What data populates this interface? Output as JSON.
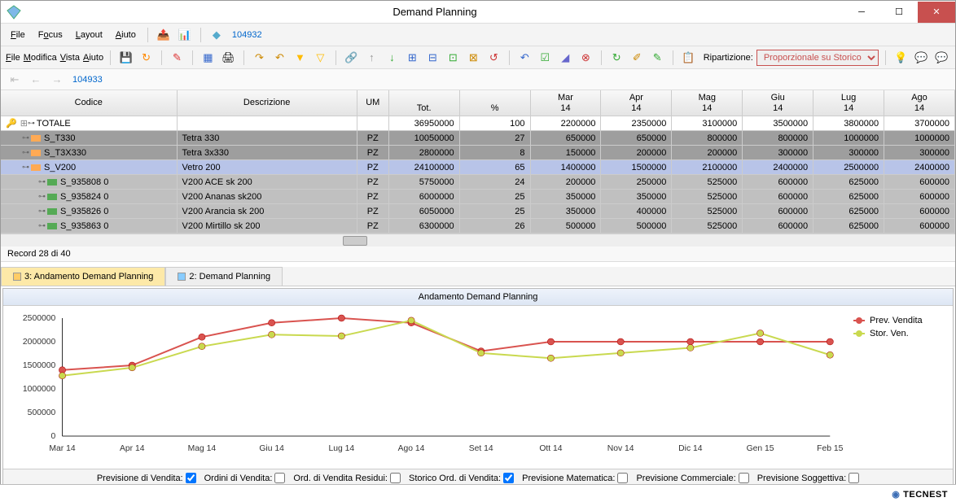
{
  "window": {
    "title": "Demand Planning",
    "id1": "104932",
    "id2": "104933"
  },
  "menus1": [
    "File",
    "Focus",
    "Layout",
    "Aiuto"
  ],
  "menus2": [
    "File",
    "Modifica",
    "Vista",
    "Aiuto"
  ],
  "ripart": {
    "label": "Ripartizione:",
    "value": "Proporzionale su Storico"
  },
  "status": "Record 28 di 40",
  "tabs": [
    {
      "label": "3: Andamento Demand Planning",
      "active": true
    },
    {
      "label": "2: Demand Planning",
      "active": false
    }
  ],
  "columns": {
    "code": "Codice",
    "desc": "Descrizione",
    "um": "UM",
    "tot": "Tot.",
    "pct": "%",
    "months": [
      "Mar 14",
      "Apr 14",
      "Mag 14",
      "Giu 14",
      "Lug 14",
      "Ago 14"
    ]
  },
  "rows": [
    {
      "t": "total",
      "code": "TOTALE",
      "desc": "",
      "um": "",
      "tot": "36950000",
      "pct": "100",
      "m": [
        "2200000",
        "2350000",
        "3100000",
        "3500000",
        "3800000",
        "3700000"
      ]
    },
    {
      "t": "cat",
      "ind": 2,
      "code": "S_T330",
      "desc": "Tetra 330",
      "um": "PZ",
      "tot": "10050000",
      "pct": "27",
      "m": [
        "650000",
        "650000",
        "800000",
        "800000",
        "1000000",
        "1000000"
      ]
    },
    {
      "t": "cat",
      "ind": 2,
      "code": "S_T3X330",
      "desc": "Tetra 3x330",
      "um": "PZ",
      "tot": "2800000",
      "pct": "8",
      "m": [
        "150000",
        "200000",
        "200000",
        "300000",
        "300000",
        "300000"
      ]
    },
    {
      "t": "sel",
      "ind": 2,
      "code": "S_V200",
      "desc": "Vetro 200",
      "um": "PZ",
      "tot": "24100000",
      "pct": "65",
      "m": [
        "1400000",
        "1500000",
        "2100000",
        "2400000",
        "2500000",
        "2400000"
      ]
    },
    {
      "t": "item",
      "ind": 4,
      "code": "S_935808 0",
      "desc": "V200 ACE sk 200",
      "um": "PZ",
      "tot": "5750000",
      "pct": "24",
      "m": [
        "200000",
        "250000",
        "525000",
        "600000",
        "625000",
        "600000"
      ]
    },
    {
      "t": "item",
      "ind": 4,
      "code": "S_935824 0",
      "desc": "V200 Ananas sk200",
      "um": "PZ",
      "tot": "6000000",
      "pct": "25",
      "m": [
        "350000",
        "350000",
        "525000",
        "600000",
        "625000",
        "600000"
      ]
    },
    {
      "t": "item",
      "ind": 4,
      "code": "S_935826 0",
      "desc": "V200 Arancia sk 200",
      "um": "PZ",
      "tot": "6050000",
      "pct": "25",
      "m": [
        "350000",
        "400000",
        "525000",
        "600000",
        "625000",
        "600000"
      ]
    },
    {
      "t": "item",
      "ind": 4,
      "code": "S_935863 0",
      "desc": "V200 Mirtillo sk 200",
      "um": "PZ",
      "tot": "6300000",
      "pct": "26",
      "m": [
        "500000",
        "500000",
        "525000",
        "600000",
        "625000",
        "600000"
      ]
    }
  ],
  "checks": [
    {
      "l": "Previsione di Vendita:",
      "c": true
    },
    {
      "l": "Ordini di Vendita:",
      "c": false
    },
    {
      "l": "Ord. di Vendita Residui:",
      "c": false
    },
    {
      "l": "Storico Ord. di Vendita:",
      "c": true
    },
    {
      "l": "Previsione Matematica:",
      "c": false
    },
    {
      "l": "Previsione Commerciale:",
      "c": false
    },
    {
      "l": "Previsione Soggettiva:",
      "c": false
    }
  ],
  "chart_data": {
    "type": "line",
    "title": "Andamento Demand Planning",
    "categories": [
      "Mar 14",
      "Apr 14",
      "Mag 14",
      "Giu 14",
      "Lug 14",
      "Ago 14",
      "Set 14",
      "Ott 14",
      "Nov 14",
      "Dic 14",
      "Gen 15",
      "Feb 15"
    ],
    "ylim": [
      0,
      2500000
    ],
    "yticks": [
      0,
      500000,
      1000000,
      1500000,
      2000000,
      2500000
    ],
    "series": [
      {
        "name": "Prev. Vendita",
        "color": "#d9534f",
        "values": [
          1400000,
          1500000,
          2100000,
          2400000,
          2500000,
          2400000,
          1800000,
          2000000,
          2000000,
          2000000,
          2000000,
          2000000
        ]
      },
      {
        "name": "Stor. Ven.",
        "color": "#c9d94f",
        "values": [
          1280000,
          1450000,
          1900000,
          2150000,
          2120000,
          2450000,
          1760000,
          1650000,
          1760000,
          1870000,
          2180000,
          1720000
        ]
      }
    ]
  },
  "footer": "TECNEST"
}
